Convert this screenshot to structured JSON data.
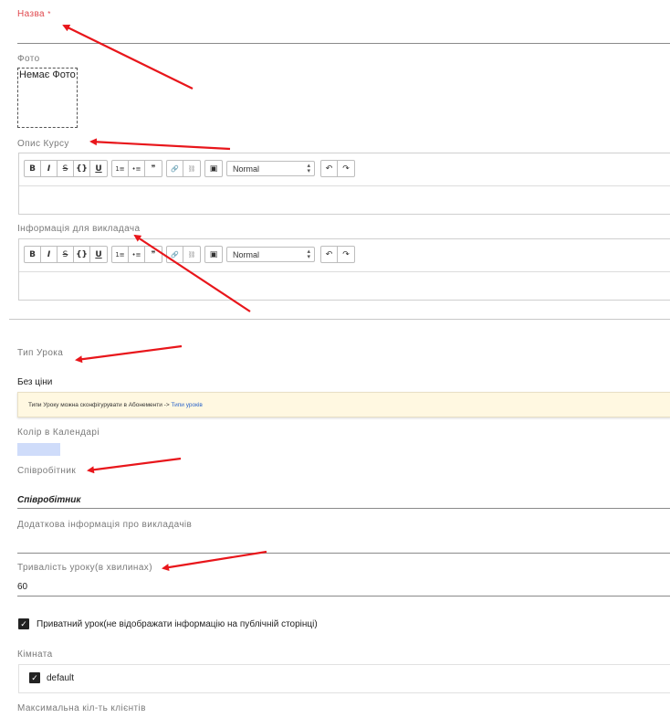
{
  "fields": {
    "name_label": "Назва",
    "name_required": "*",
    "photo_label": "Фото",
    "photo_placeholder": "Немає Фото",
    "course_desc_label": "Опис Курсу",
    "teacher_info_label": "Інформація для викладача",
    "lesson_type_label": "Тип Урока",
    "lesson_type_value": "Без ціни",
    "lesson_type_note_text": "Типи Уроку можна сконфігурувати в Абонементи ->",
    "lesson_type_note_link": "Типи уроків",
    "calendar_color_label": "Колір в Календарі",
    "calendar_color": "#cfdcfa",
    "employee_label": "Співробітник",
    "employee_value": "Співробітник",
    "extra_teacher_info_label": "Додаткова інформація про викладачів",
    "duration_label": "Тривалість уроку(в хвилинах)",
    "duration_value": "60",
    "private_label": "Приватний урок(не відображати інформацію на публічній сторінці)",
    "room_label": "Кімната",
    "room_option": "default",
    "max_clients_label": "Максимальна кіл-ть клієнтів"
  },
  "editor": {
    "format_value": "Normal",
    "buttons": {
      "bold": "B",
      "italic": "I",
      "strike": "S",
      "code": "{}",
      "underline": "U",
      "ordered_list": "1≡",
      "bullet_list": "•≡",
      "quote": "❞",
      "link": "🔗",
      "unlink": "⛓",
      "image": "▣",
      "undo": "↶",
      "redo": "↷"
    }
  },
  "annotation_color": "#e8161b"
}
